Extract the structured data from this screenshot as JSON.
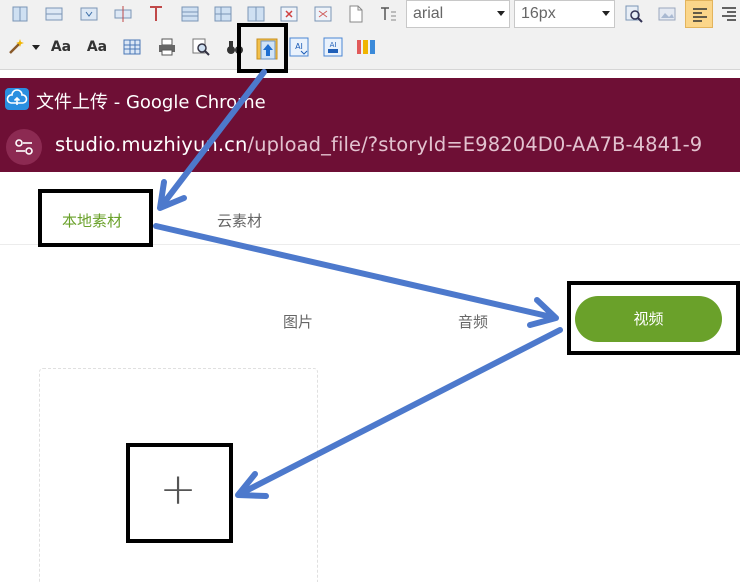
{
  "toolbar": {
    "font_family_value": "arial",
    "font_size_value": "16px",
    "row1_icons": [
      "table-col-icon",
      "table-merge-icon",
      "table-split-icon",
      "table-row-icon",
      "table-cell-icon",
      "table-icon",
      "table-insert-icon",
      "table-delete-icon",
      "page-icon",
      "text-direction-icon"
    ],
    "row2_icons": [
      "magic-wand-icon",
      "font-size-up-icon",
      "font-size-down-icon",
      "insert-table-icon",
      "print-icon",
      "preview-icon",
      "binoculars-icon",
      "upload-media-icon",
      "ai-text-icon",
      "ai-image-icon",
      "ai-format-icon"
    ],
    "right_icons": [
      "search-replace-icon",
      "image-icon",
      "align-left-icon",
      "align-right-icon"
    ]
  },
  "window": {
    "title": "文件上传 - Google Chrome",
    "url_host": "studio.muzhiyun.cn",
    "url_path": "/upload_file/?storyId=E98204D0-AA7B-4841-9"
  },
  "tabs": {
    "local": "本地素材",
    "cloud": "云素材"
  },
  "media_types": {
    "image": "图片",
    "audio": "音频",
    "video": "视频"
  },
  "upload": {
    "plus": "+"
  },
  "colors": {
    "titlebar": "#6e0f35",
    "accent_green": "#6aa12a",
    "annotation_blue": "#4d79cc",
    "annotation_frame": "#000000"
  }
}
